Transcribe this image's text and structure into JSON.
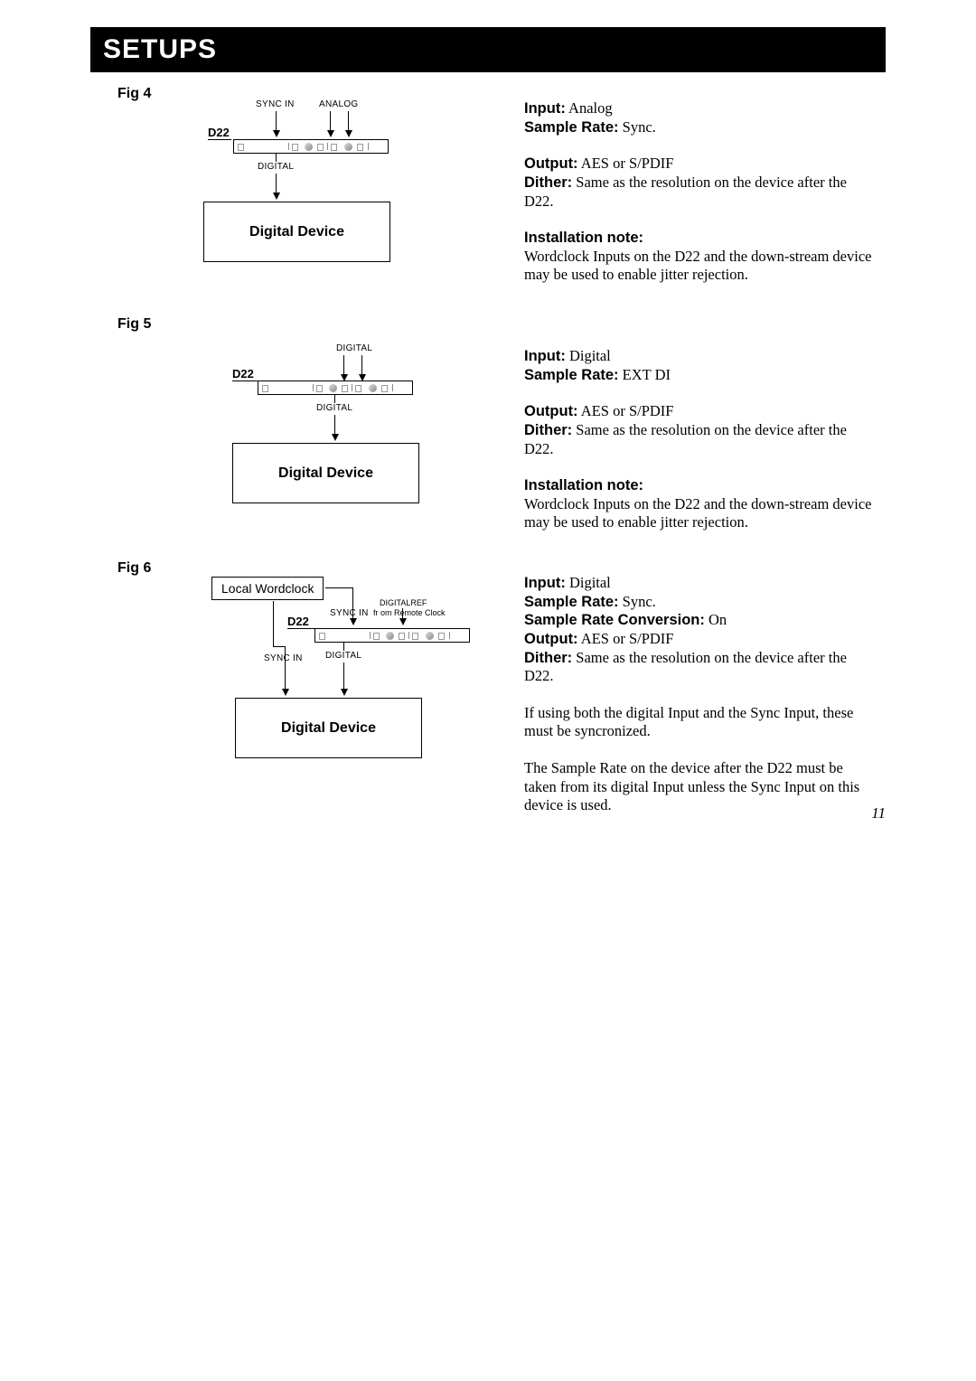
{
  "header": {
    "title": "SETUPS"
  },
  "page_number": "11",
  "common": {
    "d22_label": "D22",
    "digital_device": "Digital Device",
    "digital_label": "DIGITAL",
    "sync_in_label": "SYNC IN",
    "analog_label": "ANALOG"
  },
  "fig4": {
    "label": "Fig 4",
    "input_k": "Input:",
    "input_v": " Analog",
    "rate_k": "Sample Rate:",
    "rate_v": " Sync.",
    "output_k": "Output:",
    "output_v": " AES or S/PDIF",
    "dither_k": "Dither:",
    "dither_v": " Same as the resolution on the device after the D22.",
    "note_k": "Installation note:",
    "note_v": "Wordclock Inputs on the D22 and the down-stream device may be used to enable jitter rejection."
  },
  "fig5": {
    "label": "Fig 5",
    "input_k": "Input:",
    "input_v": " Digital",
    "rate_k": "Sample Rate:",
    "rate_v": " EXT DI",
    "output_k": "Output:",
    "output_v": " AES or S/PDIF",
    "dither_k": "Dither:",
    "dither_v": " Same as the resolution on the device after the D22.",
    "note_k": "Installation note:",
    "note_v": "Wordclock Inputs on the D22 and the down-stream device may be used to enable jitter rejection."
  },
  "fig6": {
    "label": "Fig 6",
    "wc_box": "Local  Wordclock",
    "digitalref": "DIGITALREF",
    "from_remote": "fr om Remote Clock",
    "input_k": "Input:",
    "input_v": " Digital",
    "rate_k": "Sample Rate:",
    "rate_v": " Sync.",
    "src_k": "Sample Rate Conversion:",
    "src_v": " On",
    "output_k": "Output:",
    "output_v": " AES or S/PDIF",
    "dither_k": "Dither:",
    "dither_v": " Same as the resolution on the device after the D22.",
    "para_a": "If using both the digital Input and the Sync Input, these must be syncronized.",
    "para_b": "The Sample Rate on the device after the D22 must be taken from its digital Input unless the Sync Input on this device is used."
  }
}
